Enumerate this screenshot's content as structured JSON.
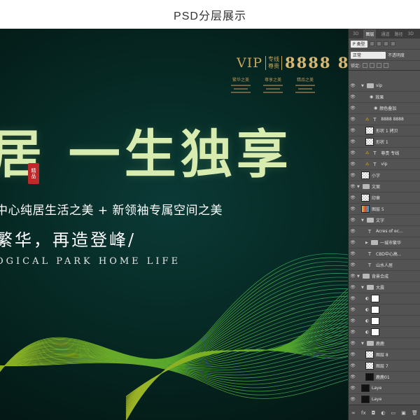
{
  "header": {
    "title": "PSD分层展示"
  },
  "poster": {
    "vip_label": "VIP",
    "vip_sub_1": "专线",
    "vip_sub_2": "尊贵",
    "phone": "8888 8",
    "headline": "居 一生独享",
    "seal_text": "精品",
    "subline": "中心纯居生活之美 + 新领袖专属空间之美",
    "tagline": "繁华，再造登峰/",
    "english": "OGICAL PARK HOME LIFE",
    "info": [
      "繁华之美",
      "尊享之美",
      "精品之美"
    ],
    "colors": {
      "bg": "#062823",
      "gold": "#c7a65a",
      "wave_green": "#8fd81f",
      "wave_teal": "#1fb5a4"
    }
  },
  "layers_panel": {
    "tabs": [
      "3D",
      "图层",
      "通道",
      "路径",
      "3D"
    ],
    "filter": "P 类型",
    "blend_mode": "正常",
    "opacity_label": "不透明度",
    "lock_label": "锁定:",
    "layers": [
      {
        "name": "vip",
        "kind": "folder",
        "indent": 1,
        "open": true
      },
      {
        "name": "效果",
        "kind": "fx",
        "indent": 3
      },
      {
        "name": "颜色叠加",
        "kind": "effect",
        "indent": 4
      },
      {
        "name": "8888 8888",
        "kind": "text-warn",
        "indent": 2
      },
      {
        "name": "形状 1 拷贝",
        "kind": "shape",
        "indent": 2
      },
      {
        "name": "形状 1",
        "kind": "shape",
        "indent": 2
      },
      {
        "name": "尊贵 专线",
        "kind": "text-warn",
        "indent": 2
      },
      {
        "name": "vip",
        "kind": "text-warn",
        "indent": 2
      },
      {
        "name": "小字",
        "kind": "image",
        "indent": 1
      },
      {
        "name": "文案",
        "kind": "folder",
        "indent": 0,
        "open": true
      },
      {
        "name": "印章",
        "kind": "image",
        "indent": 1
      },
      {
        "name": "图层 5",
        "kind": "image-color",
        "indent": 1
      },
      {
        "name": "文字",
        "kind": "folder",
        "indent": 1,
        "open": true
      },
      {
        "name": "Acres of ec...",
        "kind": "text",
        "indent": 2
      },
      {
        "name": "一城市繁华",
        "kind": "folder",
        "indent": 2,
        "open": false
      },
      {
        "name": "CBD中心高...",
        "kind": "text",
        "indent": 2
      },
      {
        "name": "山水人居",
        "kind": "text",
        "indent": 2
      },
      {
        "name": "背景合成",
        "kind": "folder",
        "indent": 0,
        "open": true
      },
      {
        "name": "大震",
        "kind": "folder",
        "indent": 1,
        "open": true
      },
      {
        "name": "",
        "kind": "adjust",
        "indent": 2
      },
      {
        "name": "",
        "kind": "adjust",
        "indent": 2
      },
      {
        "name": "",
        "kind": "adjust",
        "indent": 2
      },
      {
        "name": "",
        "kind": "adjust",
        "indent": 2
      },
      {
        "name": "鹿鹿",
        "kind": "folder",
        "indent": 1,
        "open": true
      },
      {
        "name": "图层 8",
        "kind": "image",
        "indent": 2
      },
      {
        "name": "图层 7",
        "kind": "image",
        "indent": 2
      },
      {
        "name": "鹿鹿01",
        "kind": "image-dark",
        "indent": 2
      },
      {
        "name": "Laye",
        "kind": "image-dark",
        "indent": 1
      },
      {
        "name": "Laye",
        "kind": "image-dark",
        "indent": 1
      },
      {
        "name": "Layer 21 拷贝",
        "kind": "image-dark",
        "indent": 1,
        "selected": true
      }
    ],
    "footer_icons": [
      "link-icon",
      "fx-icon",
      "mask-icon",
      "adjust-icon",
      "folder-icon",
      "new-icon",
      "trash-icon"
    ],
    "footer_glyphs": [
      "∞",
      "fx",
      "◘",
      "◐",
      "▭",
      "▣",
      "🗑"
    ]
  }
}
